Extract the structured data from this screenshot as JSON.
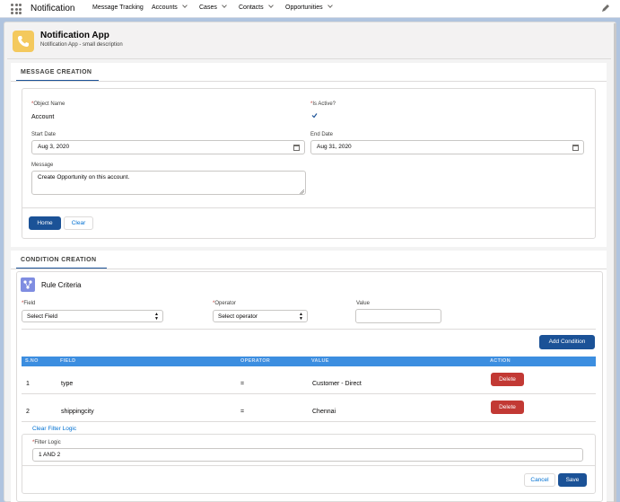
{
  "nav": {
    "app_name": "Notification",
    "items": [
      {
        "label": "Message Tracking",
        "has_menu": false
      },
      {
        "label": "Accounts",
        "has_menu": true
      },
      {
        "label": "Cases",
        "has_menu": true
      },
      {
        "label": "Contacts",
        "has_menu": true
      },
      {
        "label": "Opportunities",
        "has_menu": true
      }
    ],
    "icons": [
      "app-launcher-icon",
      "edit-pencil-icon"
    ]
  },
  "header": {
    "title": "Notification App",
    "subtitle": "Notification App - small description",
    "icon": "phone-icon",
    "icon_color": "#f4c95d"
  },
  "message_creation": {
    "section_title": "MESSAGE CREATION",
    "object_name_label": "Object Name",
    "object_name_value": "Account",
    "is_active_label": "Is Active?",
    "is_active_checked": true,
    "start_date_label": "Start Date",
    "start_date_value": "Aug 3, 2020",
    "end_date_label": "End Date",
    "end_date_value": "Aug 31, 2020",
    "message_label": "Message",
    "message_value": "Create Opportunity on this account.",
    "home_button": "Home",
    "clear_button": "Clear"
  },
  "condition_creation": {
    "section_title": "CONDITION CREATION",
    "rule_criteria_title": "Rule Criteria",
    "field_label": "Field",
    "field_value": "Select Field",
    "operator_label": "Operator",
    "operator_value": "Select operator",
    "value_label": "Value",
    "value_value": "",
    "add_condition_button": "Add Condition",
    "table": {
      "headers": [
        "S.NO",
        "FIELD",
        "OPERATOR",
        "VALUE",
        "ACTION"
      ],
      "rows": [
        {
          "sno": "1",
          "field": "type",
          "operator": "=",
          "value": "Customer - Direct",
          "action": "Delete"
        },
        {
          "sno": "2",
          "field": "shippingcity",
          "operator": "=",
          "value": "Chennai",
          "action": "Delete"
        }
      ]
    },
    "clear_filter_logic_link": "Clear Filter Logic",
    "filter_logic_label": "Filter Logic",
    "filter_logic_value": "1 AND 2",
    "cancel_button": "Cancel",
    "save_button": "Save"
  },
  "colors": {
    "brand": "#1b5297",
    "table_header": "#3c8ee0",
    "delete": "#c23934",
    "link": "#0070d2"
  }
}
